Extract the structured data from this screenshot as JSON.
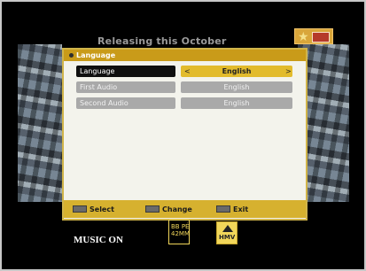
{
  "overlay": {
    "top_caption": "Releasing this October",
    "music_on": "MUSIC ON"
  },
  "menu": {
    "title": "Language",
    "items": [
      {
        "label": "Language",
        "value": "English",
        "state": "active",
        "left_arrow": "<",
        "right_arrow": ">"
      },
      {
        "label": "First Audio",
        "value": "English",
        "state": "inactive"
      },
      {
        "label": "Second Audio",
        "value": "English",
        "state": "inactive"
      }
    ]
  },
  "help": {
    "select": "Select",
    "change": "Change",
    "exit": "Exit"
  },
  "badges": {
    "badge1_text": "BB PÉ\n42MM",
    "badge2_text": "HMV"
  },
  "colors": {
    "accent": "#d6b12f",
    "active_label_bg": "#0f0f0f",
    "inactive_bg": "#a9a9a9"
  }
}
